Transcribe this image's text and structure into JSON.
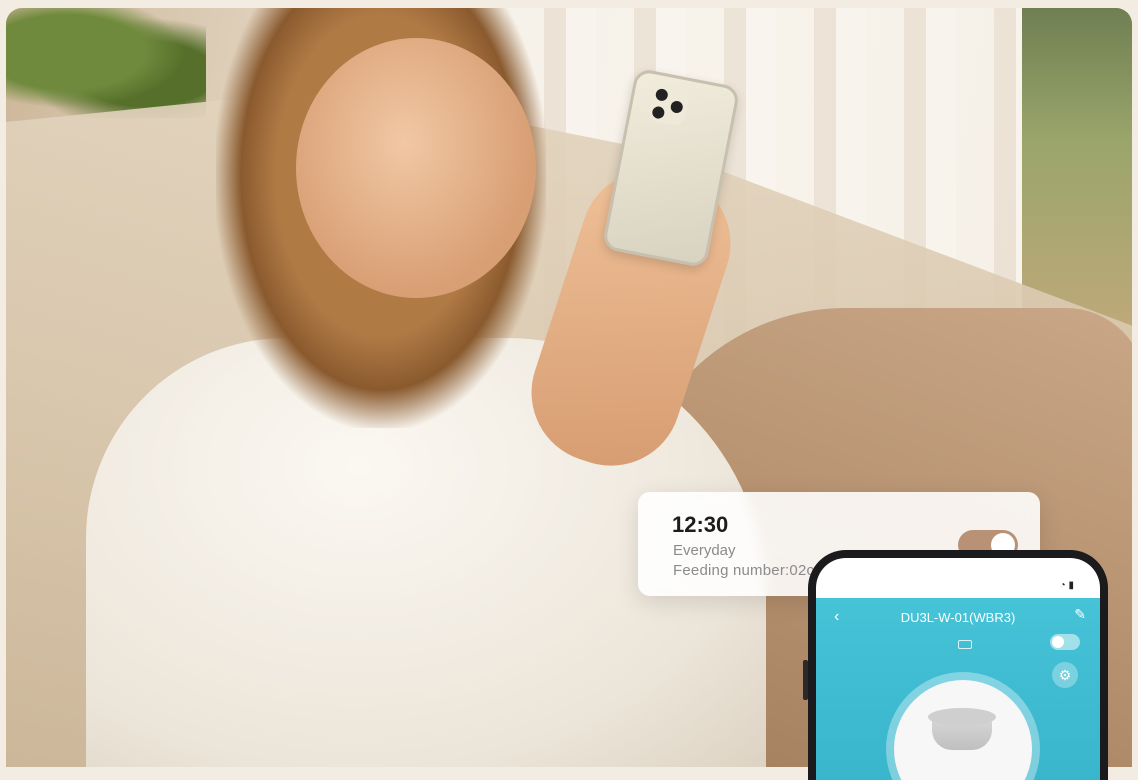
{
  "schedule_card": {
    "time": "12:30",
    "repeat": "Everyday",
    "feeding": "Feeding number:02copies",
    "enabled": true
  },
  "app": {
    "device_name": "DU3L-W-01(WBR3)",
    "back_icon": "chevron-left-icon",
    "edit_icon": "pencil-icon",
    "settings_icon": "gear-icon",
    "accent_color": "#3ab8cf",
    "toggle_color": "#b99275"
  }
}
